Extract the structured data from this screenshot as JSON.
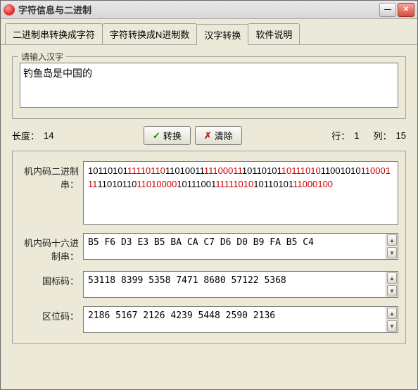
{
  "window": {
    "title": "字符信息与二进制"
  },
  "tabs": {
    "items": [
      {
        "label": "二进制串转换成字符"
      },
      {
        "label": "字符转换成N进制数"
      },
      {
        "label": "汉字转换"
      },
      {
        "label": "软件说明"
      }
    ],
    "active": 2
  },
  "input_group": {
    "legend": "请输入汉字",
    "value": "钓鱼岛是中国的"
  },
  "status": {
    "length_label": "长度：",
    "length_value": "14",
    "row_label": "行：",
    "row_value": "1",
    "col_label": "列：",
    "col_value": "15"
  },
  "buttons": {
    "convert": "转换",
    "clear": "清除"
  },
  "fields": {
    "binary_label": "机内码二进制串：",
    "binary_segments": [
      {
        "t": "10110101",
        "r": false
      },
      {
        "t": "11110110",
        "r": true
      },
      {
        "t": "11010011",
        "r": false
      },
      {
        "t": "11100011",
        "r": true
      },
      {
        "t": "10110101",
        "r": false
      },
      {
        "t": "10111010",
        "r": true
      },
      {
        "t": "11001010",
        "r": false
      },
      {
        "t": "11000111",
        "r": true
      },
      {
        "t": "11010110",
        "r": false
      },
      {
        "t": "11010000",
        "r": true
      },
      {
        "t": "10111001",
        "r": false
      },
      {
        "t": "11111010",
        "r": true
      },
      {
        "t": "10110101",
        "r": false
      },
      {
        "t": "11000100",
        "r": true
      }
    ],
    "hex_label": "机内码十六进制串：",
    "hex_value": "B5 F6 D3 E3 B5 BA CA C7 D6 D0 B9 FA B5 C4",
    "gb_label": "国标码：",
    "gb_value": "53118 8399 5358 7471 8680 57122 5368",
    "qw_label": "区位码：",
    "qw_value": "2186 5167 2126 4239 5448 2590 2136"
  }
}
